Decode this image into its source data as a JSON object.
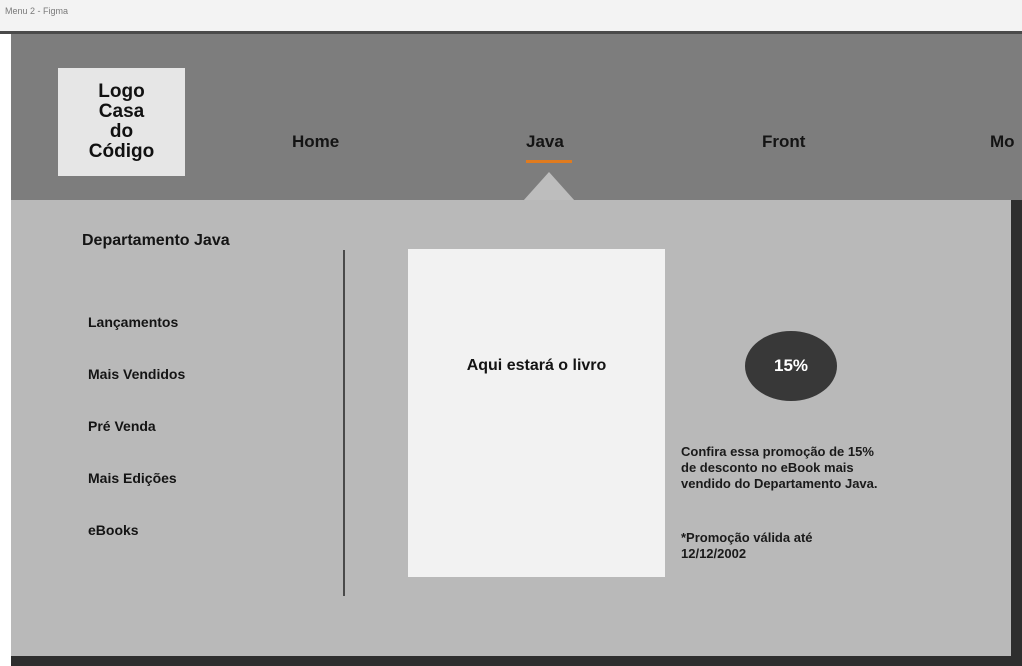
{
  "window": {
    "title": "Menu 2 - Figma"
  },
  "logo": {
    "text": "Logo Casa do Código"
  },
  "nav": {
    "items": [
      {
        "label": "Home"
      },
      {
        "label": "Java"
      },
      {
        "label": "Front"
      },
      {
        "label": "Mo"
      }
    ],
    "active": "Java",
    "accent_color": "#e07b1f"
  },
  "department": {
    "title": "Departamento Java",
    "menu": [
      {
        "label": "Lançamentos"
      },
      {
        "label": "Mais Vendidos"
      },
      {
        "label": "Pré Venda"
      },
      {
        "label": "Mais Edições"
      },
      {
        "label": "eBooks"
      }
    ]
  },
  "book": {
    "placeholder": "Aqui estará o livro"
  },
  "promo": {
    "badge": "15%",
    "lines": [
      "Confira essa promoção de 15%",
      "de desconto no eBook mais",
      "vendido do Departamento Java."
    ],
    "validity": [
      "*Promoção válida até",
      "12/12/2002"
    ]
  }
}
